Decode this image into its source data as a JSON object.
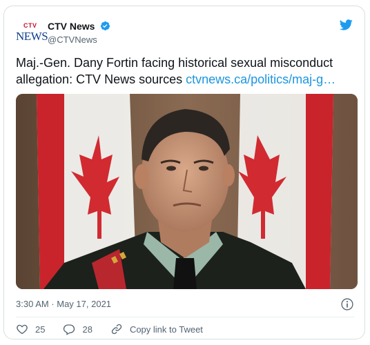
{
  "account": {
    "logo_top": "CTV",
    "logo_bottom": "NEWS",
    "display_name": "CTV News",
    "handle": "@CTVNews",
    "verified": true
  },
  "tweet": {
    "text": "Maj.-Gen. Dany Fortin facing historical sexual misconduct allegation: CTV News sources ",
    "link_text": "ctvnews.ca/politics/maj-g…",
    "timestamp": "3:30 AM · May 17, 2021"
  },
  "actions": {
    "like_count": "25",
    "reply_count": "28",
    "copy_link_label": "Copy link to Tweet"
  },
  "icons": {
    "twitter": "twitter-bird-icon",
    "verified": "verified-badge-icon",
    "info": "info-icon",
    "like": "heart-icon",
    "reply": "reply-icon",
    "copy_link": "link-icon"
  },
  "colors": {
    "brand_blue": "#1d9bf0",
    "link_blue": "#1b95e0",
    "text": "#0f1419",
    "secondary_text": "#536471",
    "ctv_red": "#c8102e",
    "ctv_navy": "#0f3f8c"
  }
}
